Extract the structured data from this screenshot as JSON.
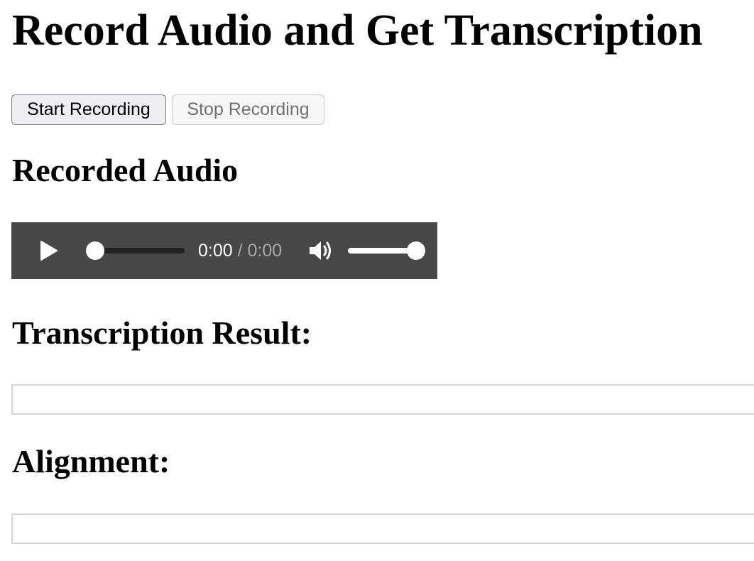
{
  "page": {
    "title": "Record Audio and Get Transcription"
  },
  "controls": {
    "start_label": "Start Recording",
    "stop_label": "Stop Recording",
    "stop_disabled": true
  },
  "recorded_audio": {
    "heading": "Recorded Audio",
    "player": {
      "current_time": "0:00",
      "separator": " / ",
      "duration": "0:00",
      "progress_fraction": 0,
      "volume_fraction": 1,
      "icons": {
        "play": "play-icon",
        "volume": "volume-icon"
      },
      "background_color": "#474747"
    }
  },
  "transcription": {
    "heading": "Transcription Result:",
    "value": ""
  },
  "alignment": {
    "heading": "Alignment:",
    "value": ""
  }
}
